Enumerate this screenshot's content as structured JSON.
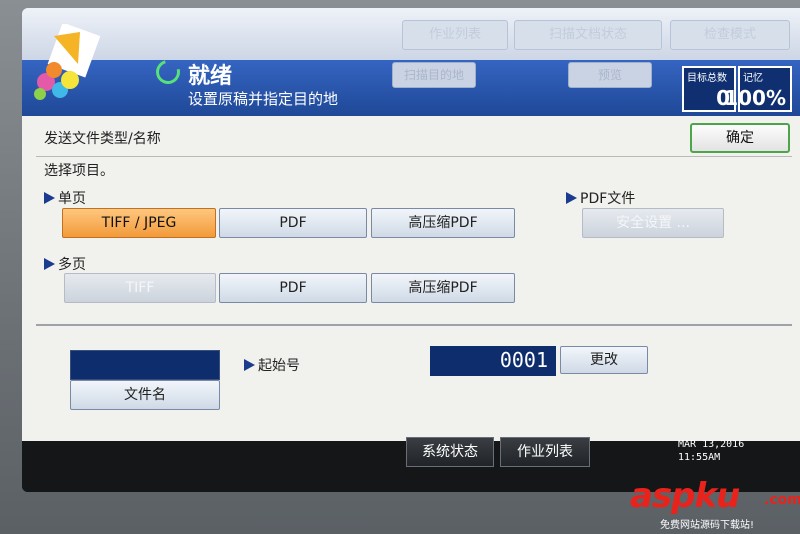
{
  "header": {
    "ghost_tabs": [
      "作业列表",
      "扫描文档状态",
      "检查模式"
    ],
    "status_title": "就绪",
    "status_sub": "设置原稿并指定目的地",
    "ghost_btn1": "扫描目的地",
    "ghost_btn2": "预览",
    "counter1_label": "目标总数",
    "counter1_value": "0",
    "counter2_label": "记忆",
    "counter2_value": "100%"
  },
  "panel": {
    "title": "发送文件类型/名称",
    "ok_label": "确定",
    "prompt": "选择项目。"
  },
  "single_page": {
    "label": "单页",
    "options": [
      "TIFF / JPEG",
      "PDF",
      "高压缩PDF"
    ]
  },
  "multi_page": {
    "label": "多页",
    "options": [
      "TIFF",
      "PDF",
      "高压缩PDF"
    ]
  },
  "pdf_file": {
    "label": "PDF文件",
    "security_label": "安全设置 ..."
  },
  "file_name": {
    "button_label": "文件名"
  },
  "start_no": {
    "label": "起始号",
    "value": "0001",
    "change_label": "更改"
  },
  "footer": {
    "system_status": "系统状态",
    "job_list": "作业列表",
    "date": "MAR  13,2016",
    "time": "11:55AM"
  },
  "watermark": {
    "brand": "aspku",
    "tld": ".com",
    "tagline": "免费网站源码下载站!"
  },
  "colors": {
    "selected": "#f29a39",
    "header_blue": "#2b58b4",
    "ok_border": "#4ca54a",
    "watermark_red": "#e9231b"
  }
}
